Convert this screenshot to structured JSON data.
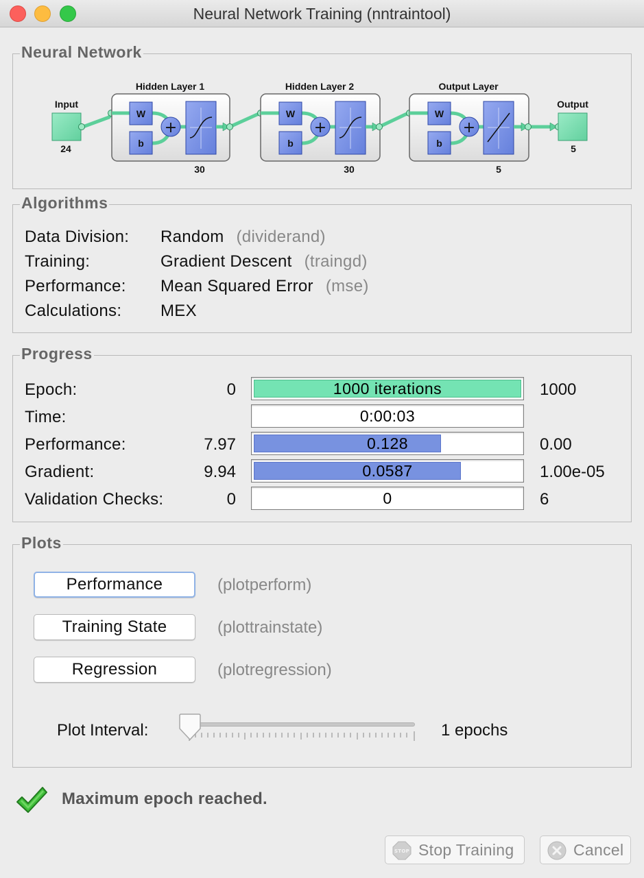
{
  "window": {
    "title": "Neural Network Training (nntraintool)"
  },
  "network": {
    "section_title": "Neural Network",
    "input": {
      "label": "Input",
      "size": "24"
    },
    "layers": [
      {
        "title": "Hidden Layer 1",
        "weight": "W",
        "bias": "b",
        "size": "30",
        "transfer": "sigmoid"
      },
      {
        "title": "Hidden Layer 2",
        "weight": "W",
        "bias": "b",
        "size": "30",
        "transfer": "sigmoid"
      },
      {
        "title": "Output Layer",
        "weight": "W",
        "bias": "b",
        "size": "5",
        "transfer": "linear"
      }
    ],
    "output": {
      "label": "Output",
      "size": "5"
    },
    "colors": {
      "node_green": "#7ee0b0",
      "layer_blue": "#7c93e6",
      "wire_green": "#5ccf9a"
    }
  },
  "algorithms": {
    "section_title": "Algorithms",
    "rows": [
      {
        "label": "Data Division:",
        "value": "Random",
        "code": "(dividerand)"
      },
      {
        "label": "Training:",
        "value": "Gradient Descent",
        "code": "(traingd)"
      },
      {
        "label": "Performance:",
        "value": "Mean Squared Error",
        "code": "(mse)"
      },
      {
        "label": "Calculations:",
        "value": "MEX",
        "code": ""
      }
    ]
  },
  "progress": {
    "section_title": "Progress",
    "rows": [
      {
        "label": "Epoch:",
        "start": "0",
        "bar_text": "1000 iterations",
        "end": "1000",
        "fill": 1.0,
        "color": "#74e3b3"
      },
      {
        "label": "Time:",
        "start": "",
        "bar_text": "0:00:03",
        "end": "",
        "fill": 0,
        "color": "#ffffff"
      },
      {
        "label": "Performance:",
        "start": "7.97",
        "bar_text": "0.128",
        "end": "0.00",
        "fill": 0.7,
        "color": "#7892e0"
      },
      {
        "label": "Gradient:",
        "start": "9.94",
        "bar_text": "0.0587",
        "end": "1.00e-05",
        "fill": 0.775,
        "color": "#7892e0"
      },
      {
        "label": "Validation Checks:",
        "start": "0",
        "bar_text": "0",
        "end": "6",
        "fill": 0,
        "color": "#ffffff"
      }
    ]
  },
  "plots": {
    "section_title": "Plots",
    "buttons": [
      {
        "label": "Performance",
        "code": "(plotperform)"
      },
      {
        "label": "Training State",
        "code": "(plottrainstate)"
      },
      {
        "label": "Regression",
        "code": "(plotregression)"
      }
    ],
    "interval_label": "Plot Interval:",
    "interval_value": "1 epochs"
  },
  "status": {
    "message": "Maximum epoch reached.",
    "icon": "checkmark-icon"
  },
  "buttons": {
    "stop_training": "Stop Training",
    "cancel": "Cancel"
  }
}
